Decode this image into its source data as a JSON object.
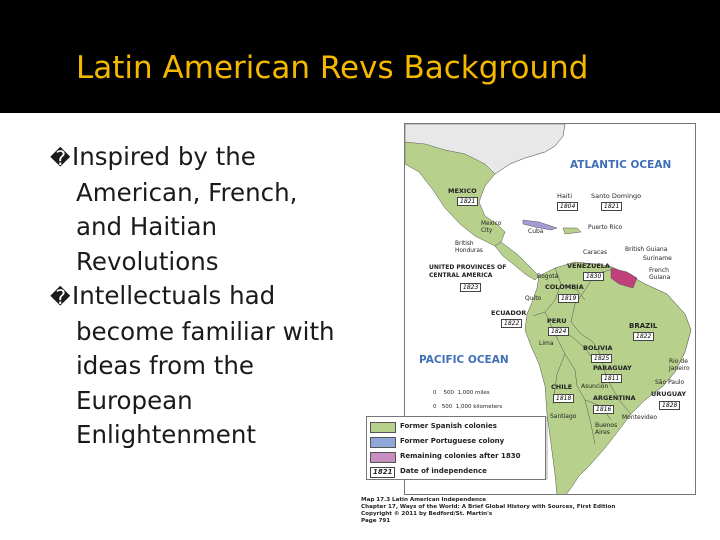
{
  "slide": {
    "title": "Latin American Revs Background",
    "bullets": [
      {
        "lines": [
          "Inspired by the",
          "American, French,",
          "and Haitian",
          "Revolutions"
        ]
      },
      {
        "lines": [
          "Intellectuals had",
          "become familiar with",
          "ideas from the",
          "European",
          "Enlightenment"
        ]
      }
    ],
    "bullet_marker": "�"
  },
  "map": {
    "oceans": {
      "atlantic": "ATLANTIC OCEAN",
      "pacific": "PACIFIC OCEAN"
    },
    "countries": [
      {
        "name": "MEXICO",
        "year": "1821"
      },
      {
        "name": "Haiti",
        "year": "1804"
      },
      {
        "name": "Santo Domingo",
        "year": "1821"
      },
      {
        "name": "UNITED PROVINCES OF CENTRAL AMERICA",
        "year": "1823"
      },
      {
        "name": "VENEZUELA",
        "year": "1830"
      },
      {
        "name": "COLOMBIA",
        "year": "1819"
      },
      {
        "name": "ECUADOR",
        "year": "1822"
      },
      {
        "name": "PERU",
        "year": "1824"
      },
      {
        "name": "BOLIVIA",
        "year": "1825"
      },
      {
        "name": "PARAGUAY",
        "year": "1811"
      },
      {
        "name": "CHILE",
        "year": "1818"
      },
      {
        "name": "ARGENTINA",
        "year": "1816"
      },
      {
        "name": "URUGUAY",
        "year": "1828"
      },
      {
        "name": "BRAZIL",
        "year": "1822"
      }
    ],
    "places": [
      "Mexico City",
      "British Honduras",
      "Cuba",
      "Puerto Rico",
      "Caracas",
      "British Guiana",
      "Suriname",
      "French Guiana",
      "Bogotá",
      "Quito",
      "Lima",
      "Asunción",
      "Rio de Janeiro",
      "São Paulo",
      "Santiago",
      "Montevideo",
      "Buenos Aires"
    ],
    "scale": {
      "miles": "0    500  1,000 miles",
      "km": "0   500  1,000 kilometers"
    },
    "legend": [
      {
        "label": "Former Spanish colonies",
        "color": "#b7d08c"
      },
      {
        "label": "Former Portuguese colony",
        "color": "#8fa8d8"
      },
      {
        "label": "Remaining colonies after 1830",
        "color": "#c98ec2"
      },
      {
        "label": "Date of independence",
        "year": "1821"
      }
    ],
    "colors": {
      "ocean": "#ffffff",
      "spanish": "#b7d08c",
      "portuguese": "#b7d08c",
      "remaining": "#c0407a",
      "border": "#555555"
    }
  },
  "caption": {
    "line1": "Map 17.3  Latin American Independence",
    "line2": "Chapter 17, Ways of the World: A Brief Global History with Sources, First Edition",
    "line3": "Copyright © 2011 by Bedford/St. Martin's",
    "line4": "Page 791"
  }
}
